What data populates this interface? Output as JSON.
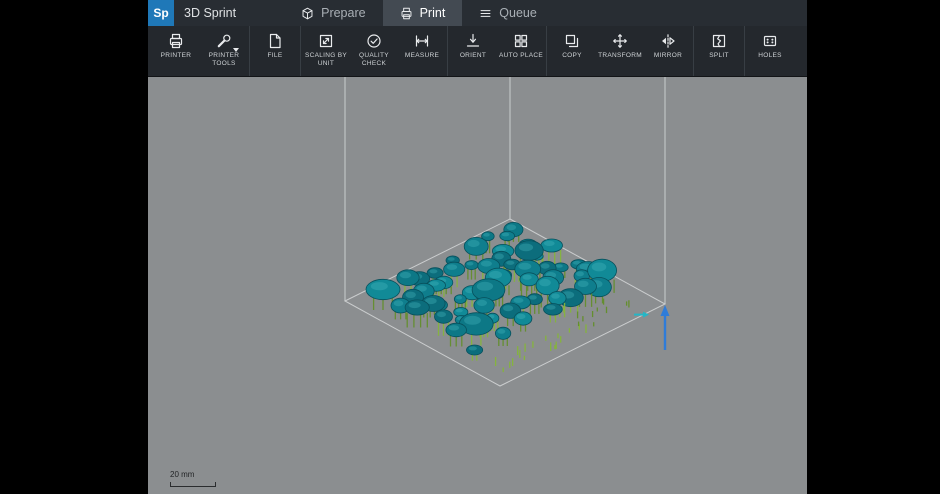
{
  "app": {
    "logo_text": "Sp",
    "title": "3D Sprint"
  },
  "tabs": [
    {
      "label": "Prepare",
      "icon": "cube-icon",
      "active": false
    },
    {
      "label": "Print",
      "icon": "printer-icon",
      "active": true
    },
    {
      "label": "Queue",
      "icon": "menu-icon",
      "active": false
    }
  ],
  "toolbar": {
    "groups": [
      {
        "buttons": [
          {
            "label": "PRINTER",
            "icon": "printer-icon",
            "dropdown": false
          },
          {
            "label": "PRINTER TOOLS",
            "icon": "wrench-icon",
            "dropdown": true
          }
        ]
      },
      {
        "buttons": [
          {
            "label": "FILE",
            "icon": "file-icon",
            "dropdown": false
          }
        ]
      },
      {
        "buttons": [
          {
            "label": "SCALING BY UNIT",
            "icon": "scaling-icon",
            "dropdown": false
          },
          {
            "label": "QUALITY CHECK",
            "icon": "quality-check-icon",
            "dropdown": false
          },
          {
            "label": "MEASURE",
            "icon": "measure-icon",
            "dropdown": false
          }
        ]
      },
      {
        "buttons": [
          {
            "label": "ORIENT",
            "icon": "orient-icon",
            "dropdown": false
          },
          {
            "label": "AUTO PLACE",
            "icon": "auto-place-icon",
            "dropdown": false
          }
        ]
      },
      {
        "buttons": [
          {
            "label": "COPY",
            "icon": "copy-icon",
            "dropdown": false
          },
          {
            "label": "TRANSFORM",
            "icon": "transform-icon",
            "dropdown": false
          },
          {
            "label": "MIRROR",
            "icon": "mirror-icon",
            "dropdown": false
          }
        ]
      },
      {
        "buttons": [
          {
            "label": "SPLIT",
            "icon": "split-icon",
            "dropdown": false
          }
        ]
      },
      {
        "buttons": [
          {
            "label": "HOLES",
            "icon": "holes-icon",
            "dropdown": false
          }
        ]
      }
    ]
  },
  "viewport": {
    "background": "#8b8e90",
    "scale_label": "20 mm",
    "scene": {
      "corners": {
        "A": [
          197,
          224
        ],
        "B": [
          362,
          142
        ],
        "D": [
          352,
          309
        ]
      },
      "line_color": "#d6d8d9",
      "model_fills": [
        "#0f7e8d",
        "#0c6d7c",
        "#118a97",
        "#0d7886"
      ],
      "model_stroke": "#07505c",
      "model_highlight": "#49b6c0",
      "support_colors": [
        "#85b43d",
        "#648f2e"
      ],
      "arrow_color": "#2f7cd9",
      "accent_arrow_color": "#25b6c6",
      "grid": {
        "cols": 12,
        "rows": 6
      },
      "seed": 12
    }
  }
}
